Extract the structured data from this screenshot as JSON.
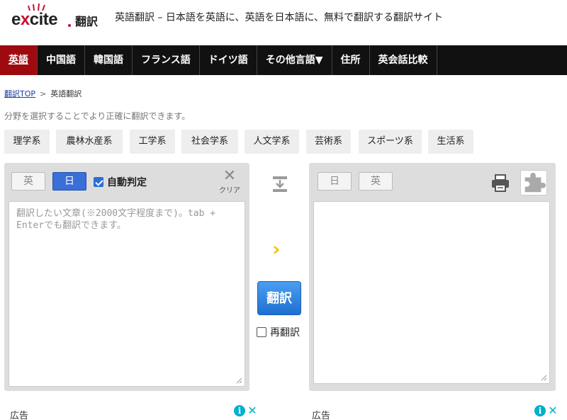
{
  "header": {
    "logo_word": "excite",
    "logo_suffix": "翻訳",
    "title": "英語翻訳 – 日本語を英語に、英語を日本語に、無料で翻訳する翻訳サイト"
  },
  "nav": {
    "items": [
      "英語",
      "中国語",
      "韓国語",
      "フランス語",
      "ドイツ語",
      "その他言語▼",
      "住所",
      "英会話比較"
    ],
    "active": 0
  },
  "breadcrumb": {
    "home": "翻訳TOP",
    "separator": ">",
    "current": "英語翻訳"
  },
  "subtitle": "分野を選択することでより正確に翻訳できます。",
  "categories": [
    "理学系",
    "農林水産系",
    "工学系",
    "社会学系",
    "人文学系",
    "芸術系",
    "スポーツ系",
    "生活系"
  ],
  "left_panel": {
    "lang_en": "英",
    "lang_ja": "日",
    "auto_detect": "自動判定",
    "auto_detect_checked": true,
    "clear_label": "クリア",
    "placeholder": "翻訳したい文章(※2000文字程度まで)。tab + Enterでも翻訳できます。"
  },
  "middle": {
    "translate_label": "翻訳",
    "retranslate_label": "再翻訳",
    "retranslate_checked": false
  },
  "right_panel": {
    "lang_ja": "日",
    "lang_en": "英",
    "output": ""
  },
  "ads": {
    "label_left": "広告",
    "label_right": "広告"
  },
  "colors": {
    "nav_bg": "#111111",
    "nav_active": "#9e0b0f",
    "translate_button": "#2d86e6",
    "selected_lang": "#3a6fd8",
    "arrow": "#f0c419"
  }
}
